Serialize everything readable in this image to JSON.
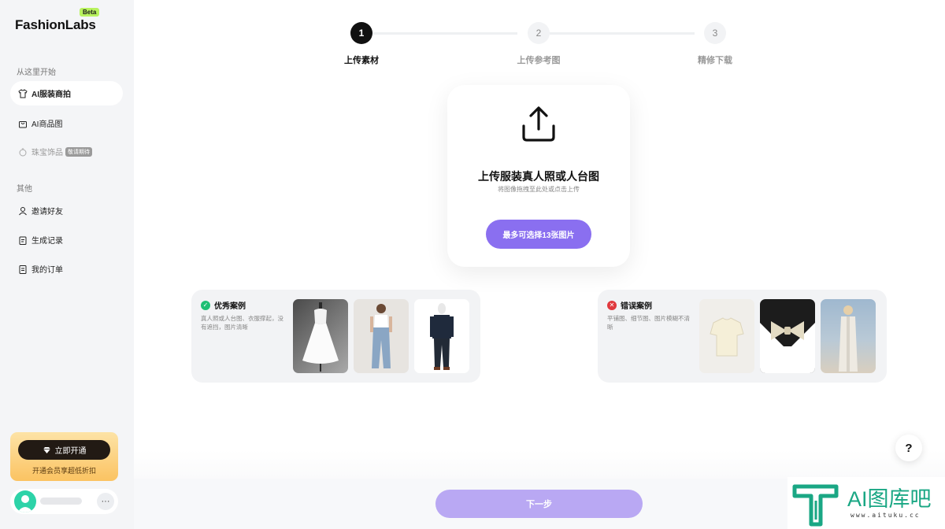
{
  "brand": {
    "name": "FashionLabs",
    "badge": "Beta"
  },
  "sidebar": {
    "section_start": "从这里开始",
    "items_start": [
      {
        "label": "AI服装商拍",
        "icon": "shirt-icon",
        "active": true
      },
      {
        "label": "AI商品图",
        "icon": "bag-icon"
      },
      {
        "label": "珠宝饰品",
        "icon": "jewelry-icon",
        "tag": "敬请期待",
        "disabled": true
      }
    ],
    "section_other": "其他",
    "items_other": [
      {
        "label": "邀请好友",
        "icon": "user-icon"
      },
      {
        "label": "生成记录",
        "icon": "clipboard-icon"
      },
      {
        "label": "我的订单",
        "icon": "order-icon"
      }
    ],
    "promo": {
      "button": "立即开通",
      "text": "开通会员享超低折扣",
      "icon": "diamond-icon"
    }
  },
  "stepper": {
    "steps": [
      {
        "number": "1",
        "label": "上传素材",
        "state": "active"
      },
      {
        "number": "2",
        "label": "上传参考图",
        "state": "todo"
      },
      {
        "number": "3",
        "label": "精修下载",
        "state": "todo"
      }
    ]
  },
  "upload": {
    "title": "上传服装真人照或人台图",
    "subtitle": "将图像拖拽至此处或点击上传",
    "button": "最多可选择13张图片",
    "icon": "upload-icon"
  },
  "examples": {
    "good": {
      "title": "优秀案例",
      "desc": "真人照或人台图、衣服撑起，没有遮挡，图片清晰",
      "icon": "check-circle-icon",
      "color": "#1fbf74"
    },
    "bad": {
      "title": "错误案例",
      "desc": "平铺图、细节图、图片模糊不清晰",
      "icon": "x-circle-icon",
      "color": "#e0393e"
    }
  },
  "help": {
    "label": "?"
  },
  "footer": {
    "next": "下一步"
  },
  "watermark": {
    "text": "AI图库吧",
    "url": "www.aituku.cc"
  },
  "colors": {
    "accent": "#8a6ff0",
    "accent_disabled": "#b9a8f3",
    "sidebar_bg": "#f4f5f7"
  }
}
